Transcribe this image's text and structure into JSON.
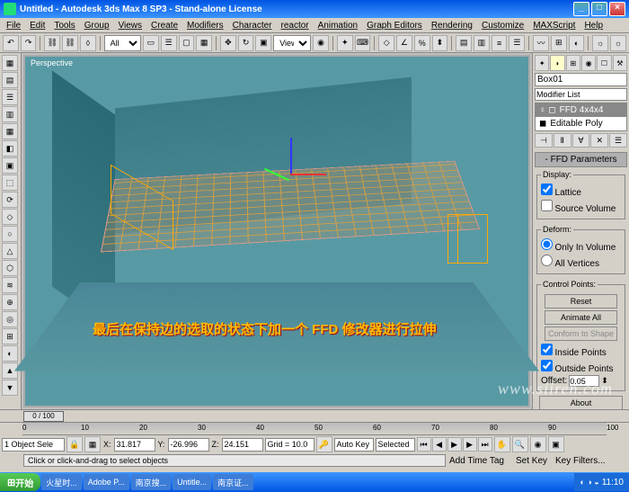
{
  "window": {
    "title": "Untitled - Autodesk 3ds Max 8 SP3 - Stand-alone License"
  },
  "menus": [
    "File",
    "Edit",
    "Tools",
    "Group",
    "Views",
    "Create",
    "Modifiers",
    "Character",
    "reactor",
    "Animation",
    "Graph Editors",
    "Rendering",
    "Customize",
    "MAXScript",
    "Help"
  ],
  "toolbar": {
    "dropdown1": "All",
    "dropdown2": "View"
  },
  "viewport": {
    "label": "Perspective",
    "annotation": "最后在保持边的选取的状态下加一个 FFD 修改器进行拉伸"
  },
  "command_panel": {
    "object_name": "Box01",
    "modifier_list_label": "Modifier List",
    "stack": [
      {
        "name": "FFD 4x4x4",
        "selected": true
      },
      {
        "name": "Editable Poly",
        "selected": false
      }
    ],
    "rollout_title": "FFD Parameters",
    "display": {
      "title": "Display:",
      "lattice": "Lattice",
      "lattice_checked": true,
      "source": "Source Volume",
      "source_checked": false
    },
    "deform": {
      "title": "Deform:",
      "in_volume": "Only In Volume",
      "all_vertices": "All Vertices"
    },
    "control_points": {
      "title": "Control Points:",
      "reset": "Reset",
      "animate": "Animate All",
      "conform": "Conform to Shape",
      "inside": "Inside Points",
      "inside_checked": true,
      "outside": "Outside Points",
      "outside_checked": true,
      "offset_label": "Offset:",
      "offset_value": "0.05"
    },
    "about": "About"
  },
  "timeline": {
    "slider": "0 / 100",
    "ticks": [
      "0",
      "10",
      "20",
      "30",
      "40",
      "50",
      "60",
      "70",
      "80",
      "90",
      "100"
    ]
  },
  "status": {
    "selection": "1 Object Sele",
    "x": "31.817",
    "y": "-26.996",
    "z": "24.151",
    "grid": "Grid = 10.0",
    "autokey": "Auto Key",
    "selected": "Selected",
    "setkey": "Set Key",
    "keyfilters": "Key Filters...",
    "prompt": "Click or click-and-drag to select objects",
    "tag": "Add Time Tag"
  },
  "taskbar": {
    "start": "开始",
    "items": [
      "火星时...",
      "Adobe P...",
      "南京搜...",
      "Untitle...",
      "南京证..."
    ],
    "time": "11:10"
  },
  "watermark": "www.siiren.com"
}
